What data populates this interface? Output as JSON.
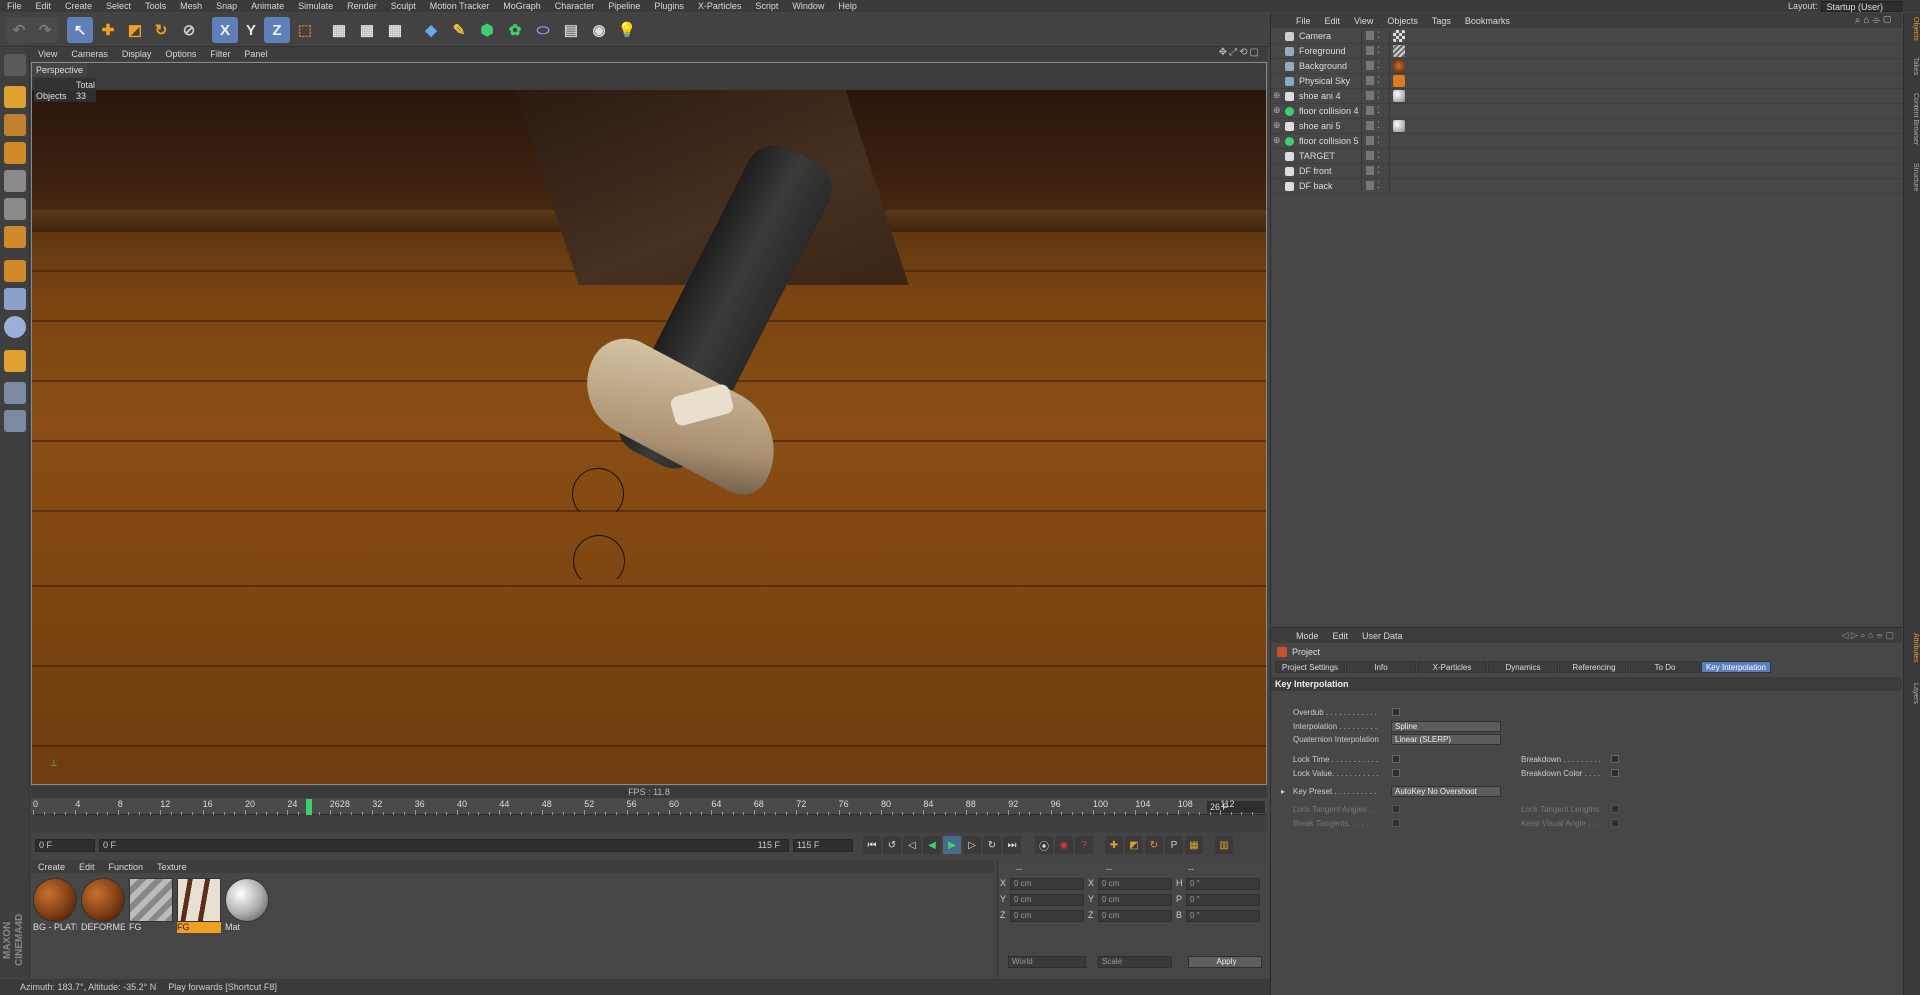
{
  "menubar": {
    "items": [
      "File",
      "Edit",
      "Create",
      "Select",
      "Tools",
      "Mesh",
      "Snap",
      "Animate",
      "Simulate",
      "Render",
      "Sculpt",
      "Motion Tracker",
      "MoGraph",
      "Character",
      "Pipeline",
      "Plugins",
      "X-Particles",
      "Script",
      "Window",
      "Help"
    ],
    "layout_label": "Layout:",
    "layout_value": "Startup (User)"
  },
  "toolbar": {
    "x_label": "X",
    "y_label": "Y",
    "z_label": "Z"
  },
  "viewport": {
    "menu": [
      "View",
      "Cameras",
      "Display",
      "Options",
      "Filter",
      "Panel"
    ],
    "name": "Perspective",
    "stats_header": "Total",
    "stats_label": "Objects",
    "stats_value": "33",
    "fps": "FPS : 11.8"
  },
  "timeline": {
    "ticks": [
      "0",
      "4",
      "8",
      "12",
      "16",
      "20",
      "24",
      "2628",
      "32",
      "36",
      "40",
      "44",
      "48",
      "52",
      "56",
      "60",
      "64",
      "68",
      "72",
      "76",
      "80",
      "84",
      "88",
      "92",
      "96",
      "100",
      "104",
      "108",
      "112"
    ],
    "current_frame": 26,
    "frame_display": "26 F",
    "start_field": "0 F",
    "range_start": "0 F",
    "range_end": "115 F",
    "end_field": "115 F"
  },
  "materials": {
    "menu": [
      "Create",
      "Edit",
      "Function",
      "Texture"
    ],
    "items": [
      {
        "label": "BG - PLATI",
        "kind": "wood-sphere"
      },
      {
        "label": "DEFORMEI",
        "kind": "wood-sphere"
      },
      {
        "label": "FG",
        "kind": "stripes"
      },
      {
        "label": "FG",
        "kind": "shoe",
        "selected": true
      },
      {
        "label": "Mat",
        "kind": "gray-sphere"
      }
    ]
  },
  "coordinates": {
    "header": [
      "--",
      "--",
      "--"
    ],
    "rows": [
      {
        "a": "X",
        "av": "0 cm",
        "b": "X",
        "bv": "0 cm",
        "c": "H",
        "cv": "0 °"
      },
      {
        "a": "Y",
        "av": "0 cm",
        "b": "Y",
        "bv": "0 cm",
        "c": "P",
        "cv": "0 °"
      },
      {
        "a": "Z",
        "av": "0 cm",
        "b": "Z",
        "bv": "0 cm",
        "c": "B",
        "cv": "0 °"
      }
    ],
    "space": "World",
    "mode": "Scale",
    "apply": "Apply"
  },
  "status": {
    "coords": "Azimuth: 183.7°, Altitude: -35.2°  N",
    "hint": "Play forwards [Shortcut F8]"
  },
  "maxon": {
    "line1": "MAXON",
    "line2": "CINEMA4D"
  },
  "objects": {
    "menu": [
      "File",
      "Edit",
      "View",
      "Objects",
      "Tags",
      "Bookmarks"
    ],
    "items": [
      {
        "name": "Camera",
        "icon": "camera-icon",
        "tag": "checker",
        "expand": false
      },
      {
        "name": "Foreground",
        "icon": "foreground-icon",
        "tag": "stripes",
        "expand": false
      },
      {
        "name": "Background",
        "icon": "background-icon",
        "tag": "brown",
        "expand": false
      },
      {
        "name": "Physical Sky",
        "icon": "sky-icon",
        "tag": "orange",
        "expand": false
      },
      {
        "name": "shoe ani 4",
        "icon": "null-icon",
        "tag": "gray",
        "expand": true
      },
      {
        "name": "floor collision 4",
        "icon": "collision-icon",
        "tag": "",
        "expand": true
      },
      {
        "name": "shoe ani 5",
        "icon": "null-icon",
        "tag": "gray",
        "expand": true
      },
      {
        "name": "floor collision 5",
        "icon": "collision-icon",
        "tag": "",
        "expand": true
      },
      {
        "name": "TARGET",
        "icon": "null-icon",
        "tag": "",
        "expand": false
      },
      {
        "name": "DF front",
        "icon": "null-icon",
        "tag": "",
        "expand": false
      },
      {
        "name": "DF back",
        "icon": "null-icon",
        "tag": "",
        "expand": false
      }
    ]
  },
  "attributes": {
    "menu": [
      "Mode",
      "Edit",
      "User Data"
    ],
    "object": "Project",
    "tabs": [
      "Project Settings",
      "Info",
      "X-Particles",
      "Dynamics",
      "Referencing",
      "To Do",
      "Key Interpolation"
    ],
    "active_tab": "Key Interpolation",
    "section": "Key Interpolation",
    "overdub": "Overdub . . . . . . . . . . . .",
    "interpolation_label": "Interpolation . . . . . . . . .",
    "interpolation_value": "Spline",
    "quaternion_label": "Quaternion Interpolation",
    "quaternion_value": "Linear (SLERP)",
    "lock_time": "Lock Time . . . . . . . . . . .",
    "lock_value": "Lock Value. . . . . . . . . . .",
    "breakdown": "Breakdown . . . . . . . . .",
    "breakdown_color": "Breakdown Color . . . .",
    "key_preset_label": "Key Preset . . . . . . . . . .",
    "key_preset_value": "AutoKey No Overshoot",
    "lock_tangent_angles": "Lock Tangent Angles . . .",
    "lock_tangent_lengths": "Lock Tangent Lengths",
    "break_tangents": "Break Tangents. . . . . . .",
    "keep_visual_angle": "Keep Visual Angle . . . ."
  },
  "side_tabs": {
    "right_top": [
      "Objects",
      "Takes",
      "Content Browser",
      "Structure"
    ],
    "right_bottom": [
      "Attributes",
      "Layers"
    ]
  },
  "colors": {
    "accent": "#5a7fbf",
    "playhead": "#3ccf6a",
    "selected_material": "#f0a020"
  }
}
